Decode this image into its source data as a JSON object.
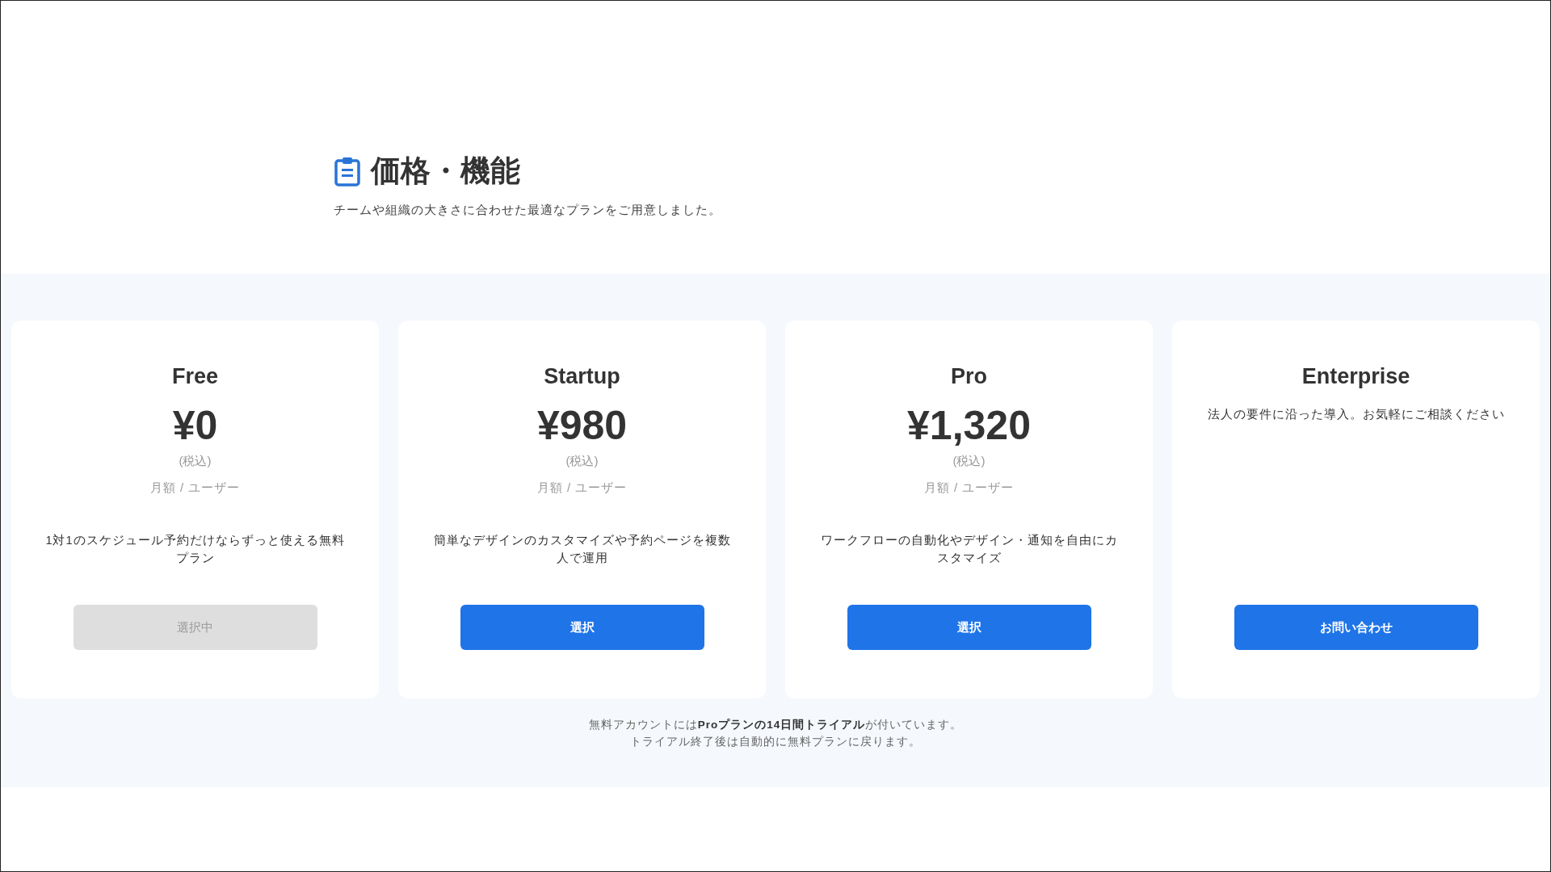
{
  "header": {
    "title": "価格・機能",
    "subtitle": "チームや組織の大きさに合わせた最適なプランをご用意しました。"
  },
  "plans": [
    {
      "name": "Free",
      "price": "¥0",
      "tax": "(税込)",
      "unit": "月額 / ユーザー",
      "description": "1対1のスケジュール予約だけならずっと使える無料プラン",
      "button": {
        "label": "選択中",
        "selected": true
      }
    },
    {
      "name": "Startup",
      "price": "¥980",
      "tax": "(税込)",
      "unit": "月額 / ユーザー",
      "description": "簡単なデザインのカスタマイズや予約ページを複数人で運用",
      "button": {
        "label": "選択",
        "selected": false
      }
    },
    {
      "name": "Pro",
      "price": "¥1,320",
      "tax": "(税込)",
      "unit": "月額 / ユーザー",
      "description": "ワークフローの自動化やデザイン・通知を自由にカスタマイズ",
      "button": {
        "label": "選択",
        "selected": false
      }
    },
    {
      "name": "Enterprise",
      "description": "法人の要件に沿った導入。お気軽にご相談ください",
      "button": {
        "label": "お問い合わせ",
        "selected": false
      }
    }
  ],
  "footnote": [
    "無料アカウントには**Proプランの14日間トライアル**が付いています。",
    "トライアル終了後は自動的に無料プランに戻ります。"
  ]
}
